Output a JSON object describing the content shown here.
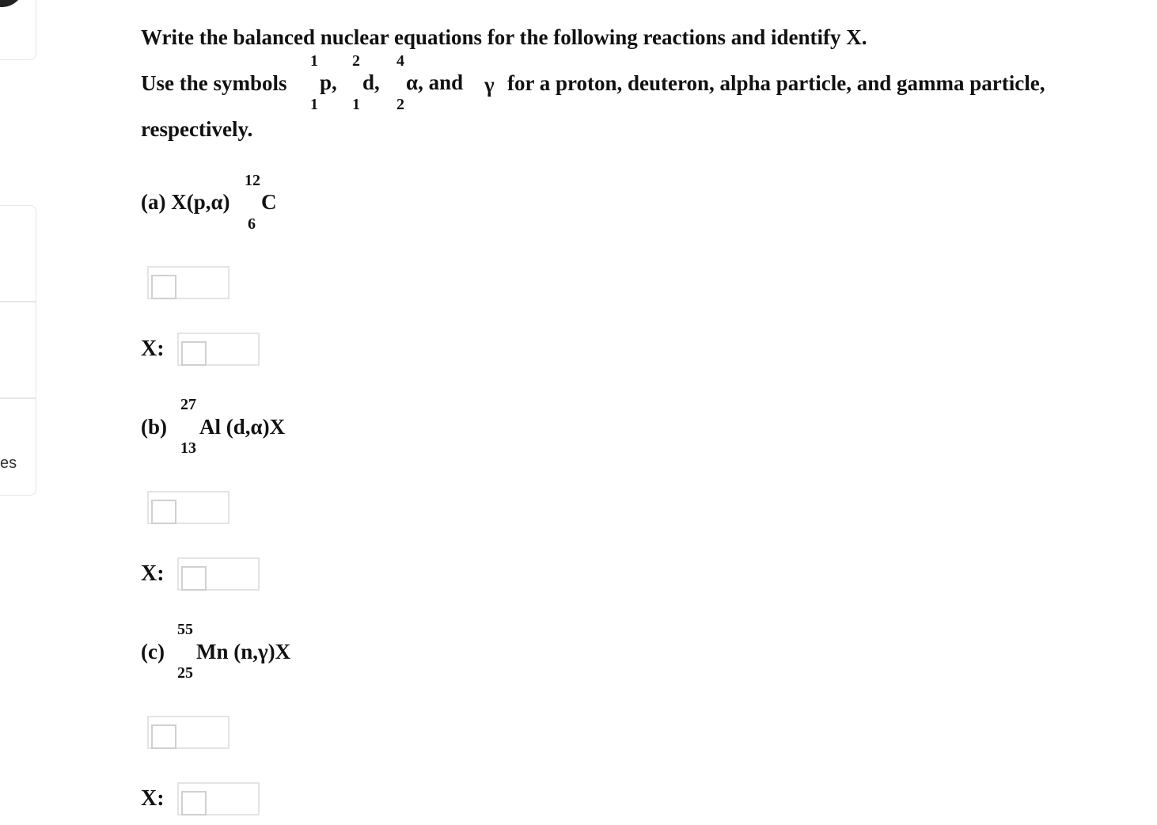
{
  "sidebar": {
    "partial_label": "es"
  },
  "question": {
    "line1": "Write the balanced nuclear equations for the following reactions and identify X.",
    "line2_prefix": "Use the symbols",
    "symbols": [
      {
        "mass": "1",
        "atomic": "1",
        "symbol": "p",
        "trail": ","
      },
      {
        "mass": "2",
        "atomic": "1",
        "symbol": "d",
        "trail": ","
      },
      {
        "mass": "4",
        "atomic": "2",
        "symbol": "α",
        "trail": ", and"
      }
    ],
    "gamma_symbol": "γ",
    "line2_suffix": "for a proton, deuteron, alpha particle, and gamma particle,",
    "line3": "respectively."
  },
  "parts": [
    {
      "label": "(a)",
      "pre": "X(p,α)",
      "mass": "12",
      "atomic": "6",
      "element": "C",
      "post": "",
      "x_label": "X:"
    },
    {
      "label": "(b)",
      "pre": "",
      "mass": "27",
      "atomic": "13",
      "element": "Al",
      "post": "(d,α)X",
      "x_label": "X:"
    },
    {
      "label": "(c)",
      "pre": "",
      "mass": "55",
      "atomic": "25",
      "element": "Mn",
      "post": "(n,γ)X",
      "x_label": "X:"
    }
  ]
}
